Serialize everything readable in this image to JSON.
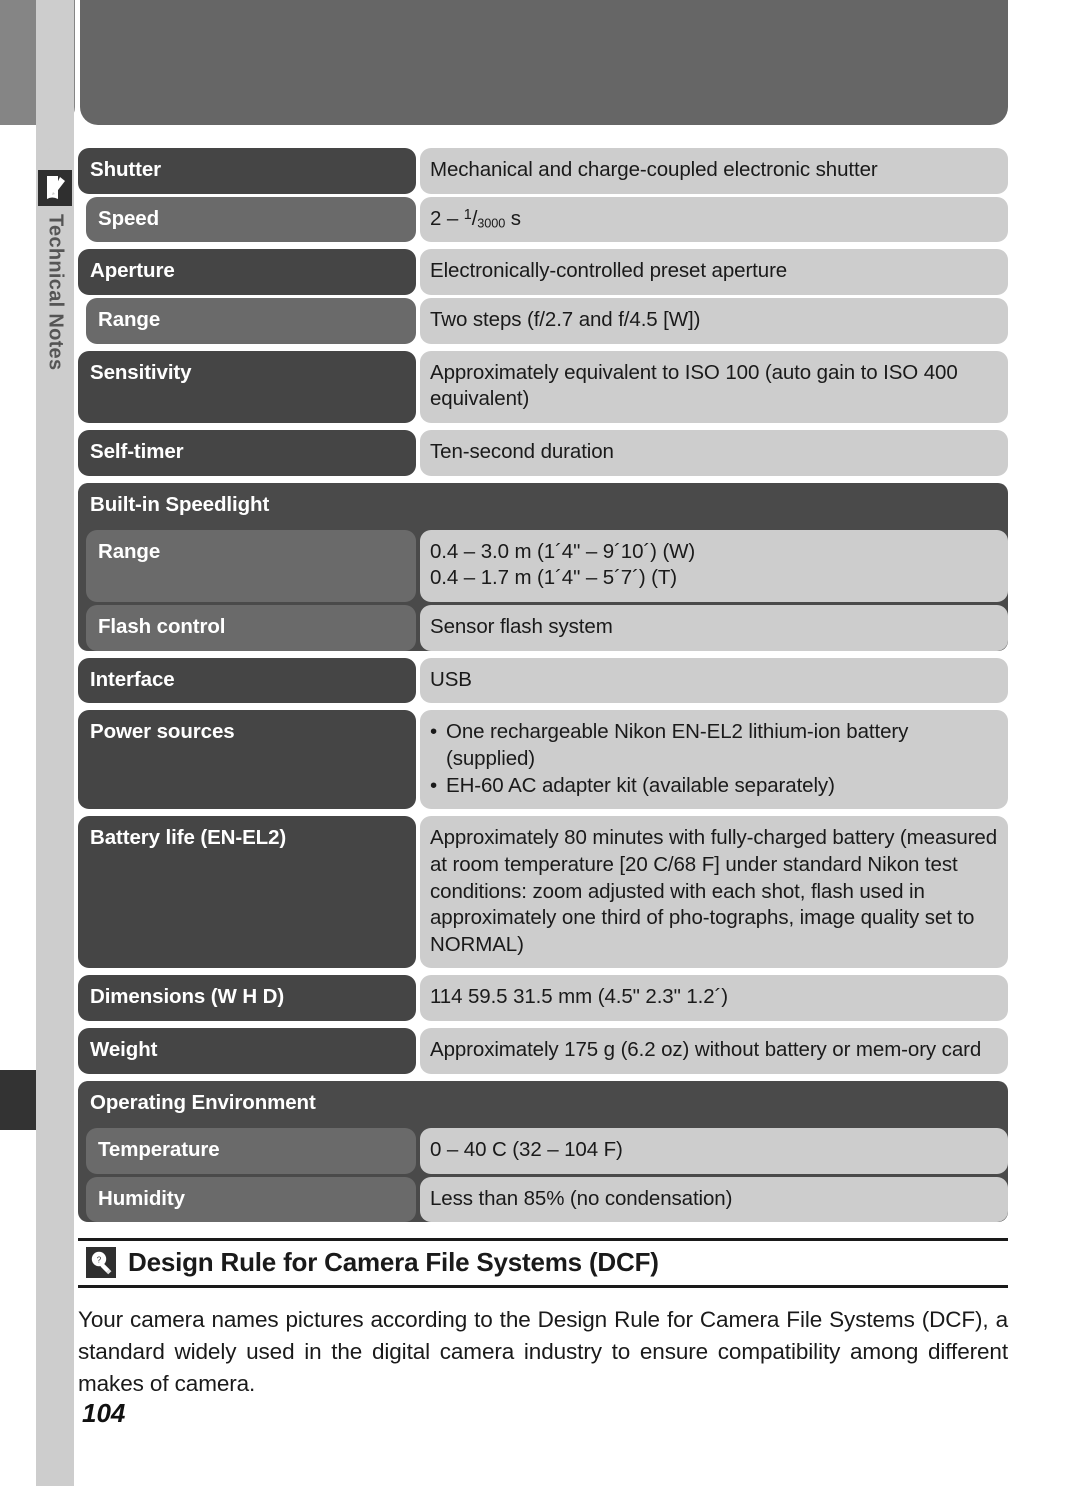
{
  "sidebar": {
    "tab_label": "Technical Notes",
    "icon": "notes-pencil-icon"
  },
  "page_number": "104",
  "spec_table": {
    "groups": [
      {
        "id": "shutter",
        "rows": [
          {
            "level": "main",
            "label": "Shutter",
            "value": "Mechanical and charge-coupled electronic shutter"
          },
          {
            "level": "sub",
            "label": "Speed",
            "value": "2 – 1/3000 s",
            "value_kind": "fraction",
            "fraction": {
              "prefix": "2 – ",
              "numerator": "1",
              "denominator": "3000",
              "suffix": " s"
            }
          }
        ]
      },
      {
        "id": "aperture",
        "rows": [
          {
            "level": "main",
            "label": "Aperture",
            "value": "Electronically-controlled preset aperture"
          },
          {
            "level": "sub",
            "label": "Range",
            "value": "Two steps (f/2.7 and f/4.5 [W])"
          }
        ]
      },
      {
        "id": "sensitivity",
        "rows": [
          {
            "level": "main",
            "label": "Sensitivity",
            "value": "Approximately equivalent to ISO 100 (auto gain to ISO 400 equivalent)"
          }
        ]
      },
      {
        "id": "self-timer",
        "rows": [
          {
            "level": "main",
            "label": "Self-timer",
            "value": "Ten-second duration"
          }
        ]
      },
      {
        "id": "built-in-speedlight",
        "boxed": true,
        "rows": [
          {
            "level": "group-head",
            "label": "Built-in Speedlight",
            "value": ""
          },
          {
            "level": "sub",
            "label": "Range",
            "value": "0.4 – 3.0 m (1´4ʺ – 9´10´) (W)\n0.4 – 1.7 m (1´4ʺ – 5´7´) (T)",
            "lines": [
              "0.4 – 3.0 m (1´4ʺ – 9´10´) (W)",
              "0.4 – 1.7 m (1´4ʺ – 5´7´) (T)"
            ]
          },
          {
            "level": "sub",
            "label": "Flash control",
            "value": "Sensor flash system"
          }
        ]
      },
      {
        "id": "interface",
        "rows": [
          {
            "level": "main",
            "label": "Interface",
            "value": "USB"
          }
        ]
      },
      {
        "id": "power-sources",
        "rows": [
          {
            "level": "main",
            "label": "Power sources",
            "value_kind": "bullets",
            "bullets": [
              "One rechargeable Nikon EN-EL2 lithium-ion battery (supplied)",
              "EH-60 AC adapter kit (available separately)"
            ]
          }
        ]
      },
      {
        "id": "battery-life",
        "rows": [
          {
            "level": "main",
            "label": "Battery life (EN-EL2)",
            "value": "Approximately 80 minutes with fully-charged battery (measured at room temperature [20  C/68  F] under standard Nikon test conditions: zoom adjusted with each shot, flash used in approximately one third of pho-tographs, image quality set to NORMAL)"
          }
        ]
      },
      {
        "id": "dimensions",
        "rows": [
          {
            "level": "main",
            "label": "Dimensions (W   H   D)",
            "value": "114   59.5   31.5 mm (4.5ʺ   2.3ʺ   1.2´)"
          }
        ]
      },
      {
        "id": "weight",
        "rows": [
          {
            "level": "main",
            "label": "Weight",
            "value": "Approximately 175 g (6.2 oz) without battery or mem-ory card"
          }
        ]
      },
      {
        "id": "operating-environment",
        "boxed": true,
        "rows": [
          {
            "level": "group-head",
            "label": "Operating Environment",
            "value": ""
          },
          {
            "level": "sub",
            "label": "Temperature",
            "value": "0 – 40  C (32 – 104  F)"
          },
          {
            "level": "sub",
            "label": "Humidity",
            "value": "Less than 85% (no condensation)"
          }
        ]
      }
    ]
  },
  "dcf_section": {
    "icon": "tip-lightbulb-icon",
    "title": "Design Rule for Camera File Systems (DCF)",
    "body": "Your camera names pictures according to the Design Rule for Camera File Systems (DCF), a standard widely used in the digital camera industry to ensure compatibility among different makes of camera."
  },
  "colors": {
    "label_dark": "#454545",
    "label_sub": "#6a6a6a",
    "value_gray": "#cdcdcd",
    "group_box": "#4a4a4a",
    "sidebar": "#cdcdcd",
    "top_left_block": "#858585",
    "top_right_block": "#666666"
  }
}
